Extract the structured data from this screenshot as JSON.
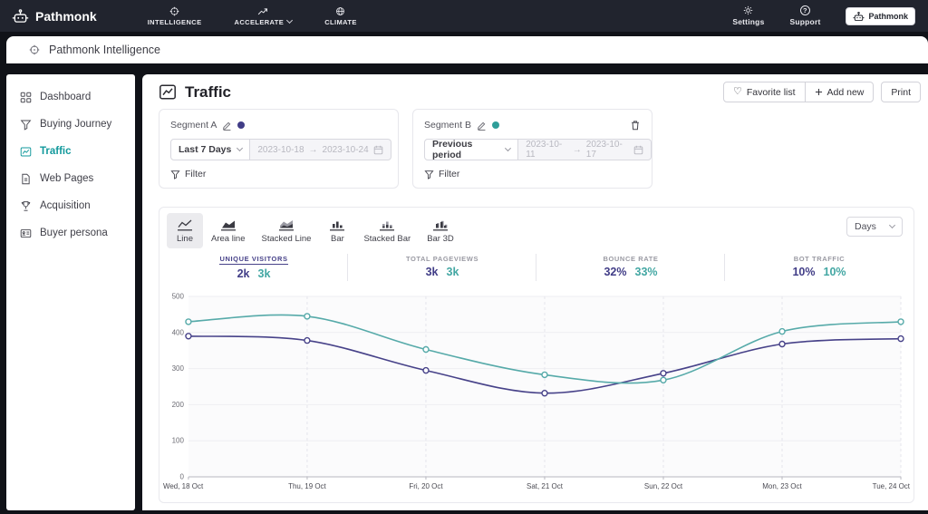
{
  "colors": {
    "navbar_bg": "#21242e",
    "accent_teal": "#2f9e99",
    "accent_purple": "#413d87",
    "sidebar_active": "#12999c"
  },
  "navbar": {
    "brand": "Pathmonk",
    "items": [
      {
        "label": "INTELLIGENCE"
      },
      {
        "label": "ACCELERATE"
      },
      {
        "label": "CLIMATE"
      }
    ],
    "settings": "Settings",
    "support": "Support",
    "account": "Pathmonk"
  },
  "breadcrumb": {
    "label": "Pathmonk Intelligence"
  },
  "sidebar": {
    "items": [
      {
        "label": "Dashboard"
      },
      {
        "label": "Buying Journey"
      },
      {
        "label": "Traffic"
      },
      {
        "label": "Web Pages"
      },
      {
        "label": "Acquisition"
      },
      {
        "label": "Buyer persona"
      }
    ]
  },
  "header": {
    "title": "Traffic",
    "favorite": "Favorite list",
    "add_new": "Add new",
    "print": "Print"
  },
  "segments": [
    {
      "name": "Segment A",
      "color": "#413d87",
      "period": "Last 7 Days",
      "date_start": "2023-10-18",
      "arrow": "→",
      "date_end": "2023-10-24",
      "filter": "Filter"
    },
    {
      "name": "Segment B",
      "color": "#2f9e99",
      "period": "Previous period",
      "date_start": "2023-10-11",
      "arrow": "→",
      "date_end": "2023-10-17",
      "filter": "Filter"
    }
  ],
  "chart_controls": {
    "tabs": [
      {
        "label": "Line"
      },
      {
        "label": "Area line"
      },
      {
        "label": "Stacked Line"
      },
      {
        "label": "Bar"
      },
      {
        "label": "Stacked Bar"
      },
      {
        "label": "Bar 3D"
      }
    ],
    "granularity": "Days"
  },
  "metrics": [
    {
      "label": "UNIQUE VISITORS",
      "segment_a": "2k",
      "segment_b": "3k"
    },
    {
      "label": "TOTAL PAGEVIEWS",
      "segment_a": "3k",
      "segment_b": "3k"
    },
    {
      "label": "BOUNCE RATE",
      "segment_a": "32%",
      "segment_b": "33%"
    },
    {
      "label": "BOT TRAFFIC",
      "segment_a": "10%",
      "segment_b": "10%"
    }
  ],
  "chart_data": {
    "type": "line",
    "title": "",
    "xlabel": "",
    "ylabel": "",
    "x": [
      "Wed, 18 Oct",
      "Thu, 19 Oct",
      "Fri, 20 Oct",
      "Sat, 21 Oct",
      "Sun, 22 Oct",
      "Mon, 23 Oct",
      "Tue, 24 Oct"
    ],
    "series": [
      {
        "name": "Segment A",
        "color": "#474289",
        "values": [
          390,
          378,
          295,
          232,
          287,
          368,
          383
        ]
      },
      {
        "name": "Segment B",
        "color": "#56aaa9",
        "values": [
          430,
          445,
          353,
          283,
          268,
          403,
          430
        ]
      }
    ],
    "ylim": [
      0,
      500
    ],
    "yticks": [
      0,
      100,
      200,
      300,
      400,
      500
    ],
    "grid": true,
    "smooth": true,
    "markers": "hollow-circle",
    "legend_position": "none"
  }
}
